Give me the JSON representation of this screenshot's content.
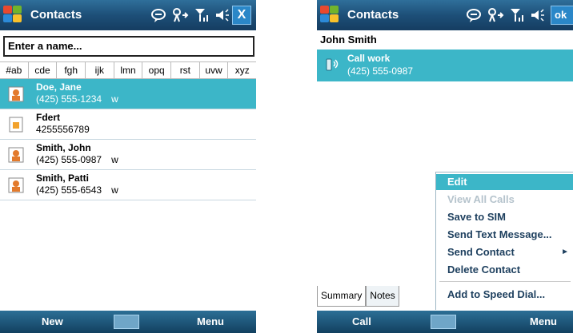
{
  "left": {
    "title": "Contacts",
    "search_placeholder": "Enter a name...",
    "letter_groups": [
      "#ab",
      "cde",
      "fgh",
      "ijk",
      "lmn",
      "opq",
      "rst",
      "uvw",
      "xyz"
    ],
    "contacts": [
      {
        "name": "Doe, Jane",
        "number": "(425) 555-1234",
        "type": "w",
        "selected": true
      },
      {
        "name": "Fdert",
        "number": "4255556789",
        "type": "",
        "selected": false
      },
      {
        "name": "Smith, John",
        "number": "(425) 555-0987",
        "type": "w",
        "selected": false
      },
      {
        "name": "Smith, Patti",
        "number": "(425) 555-6543",
        "type": "w",
        "selected": false
      }
    ],
    "soft_left": "New",
    "soft_right": "Menu",
    "close_label": "X"
  },
  "right": {
    "title": "Contacts",
    "ok_label": "ok",
    "contact_name": "John Smith",
    "call_label": "Call work",
    "call_number": "(425) 555-0987",
    "tabs": [
      "Summary",
      "Notes"
    ],
    "menu": [
      "Edit",
      "View All Calls",
      "Save to SIM",
      "Send Text Message...",
      "Send Contact",
      "Delete Contact",
      "Add to Speed Dial..."
    ],
    "soft_left": "Call",
    "soft_right": "Menu"
  },
  "colors": {
    "titlebar": "#1d4f78",
    "selection": "#3cb6c8"
  }
}
